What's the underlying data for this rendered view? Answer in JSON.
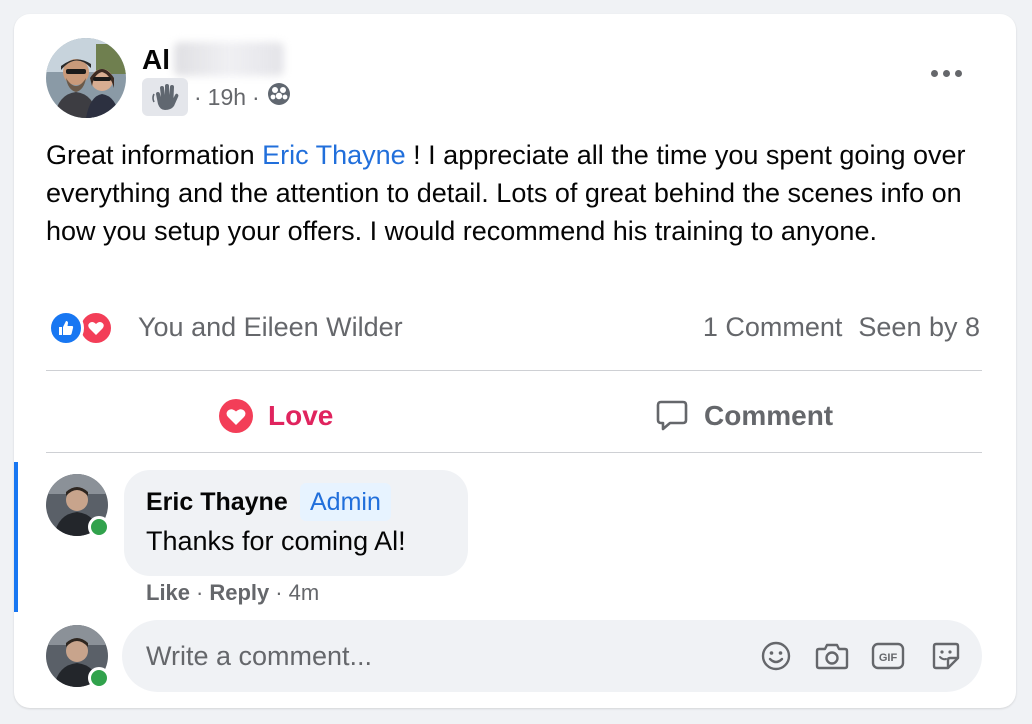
{
  "post": {
    "author_name": "Al",
    "time": "19h",
    "separator": "·",
    "text_before": "Great information ",
    "mention": "Eric Thayne",
    "text_after": " ! I appreciate all the time you spent going over everything and the attention to detail. Lots of great behind the scenes info on how you setup your offers. I would recommend his training to anyone.",
    "reacted_by": "You and Eileen Wilder",
    "comment_count": "1 Comment",
    "seen_by": "Seen by 8"
  },
  "actions": {
    "love_label": "Love",
    "comment_label": "Comment"
  },
  "comment": {
    "author": "Eric Thayne",
    "badge": "Admin",
    "text": "Thanks for coming Al!",
    "like_label": "Like",
    "reply_label": "Reply",
    "time": "4m",
    "separator": "·"
  },
  "composer": {
    "placeholder": "Write a comment...",
    "gif_label": "GIF"
  },
  "icons": {
    "wave": "wave-icon",
    "audience": "group-audience-icon",
    "more": "more-options-icon",
    "like": "like-reaction-icon",
    "love": "love-reaction-icon",
    "comment": "comment-icon",
    "emoji": "emoji-icon",
    "camera": "camera-icon",
    "gif": "gif-icon",
    "sticker": "sticker-icon"
  },
  "colors": {
    "link_blue": "#216fdb",
    "like_blue": "#1877f2",
    "love_red": "#f33e58",
    "love_action": "#e0245e",
    "online_green": "#31a24c",
    "muted_text": "#65676b",
    "bubble_bg": "#f0f2f5"
  }
}
